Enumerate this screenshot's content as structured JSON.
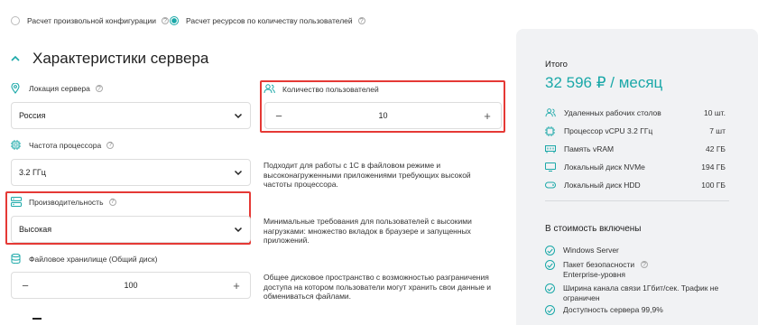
{
  "config_mode": {
    "option1_label": "Расчет произвольной конфигурации",
    "option2_label": "Расчет ресурсов по количеству пользователей"
  },
  "section": {
    "title": "Характеристики сервера"
  },
  "location": {
    "label": "Локация сервера",
    "value": "Россия"
  },
  "users": {
    "label": "Количество пользователей",
    "value": "10",
    "minus": "−",
    "plus": "+"
  },
  "cpu_freq": {
    "label": "Частота процессора",
    "value": "3.2 ГГц",
    "description": "Подходит для работы с 1С в файловом режиме и высоконагруженными приложениями требующих высокой частоты процессора."
  },
  "performance": {
    "label": "Производительность",
    "value": "Высокая",
    "description": "Минимальные требования для пользователей с высокими нагрузками: множество вкладок в браузере и запущенных приложений."
  },
  "storage": {
    "label": "Файловое хранилище (Общий диск)",
    "value": "100",
    "minus": "−",
    "plus": "+",
    "description": "Общее дисковое пространство с возможностью разграничения доступа на котором пользователи могут хранить свои данные и обмениваться файлами."
  },
  "summary": {
    "title": "Итого",
    "price": "32 596 ₽ / месяц",
    "items": [
      {
        "icon": "users-icon",
        "label": "Удаленных рабочих столов",
        "value": "10 шт."
      },
      {
        "icon": "cpu-icon",
        "label": "Процессор vCPU 3.2 ГГц",
        "value": "7 шт"
      },
      {
        "icon": "ram-icon",
        "label": "Память vRAM",
        "value": "42 ГБ"
      },
      {
        "icon": "monitor-icon",
        "label": "Локальный диск NVMe",
        "value": "194 ГБ"
      },
      {
        "icon": "disk-icon",
        "label": "Локальный диск HDD",
        "value": "100 ГБ"
      }
    ],
    "included_title": "В стоимость включены",
    "included": [
      "Windows Server",
      "Пакет безопасности Enterprise-уровня",
      "Ширина канала связи 1Гбит/сек. Трафик не ограничен",
      "Доступность сервера 99,9%"
    ]
  },
  "colors": {
    "accent": "#1aa8a8",
    "highlight": "#e53935",
    "panel": "#f1f2f4"
  }
}
